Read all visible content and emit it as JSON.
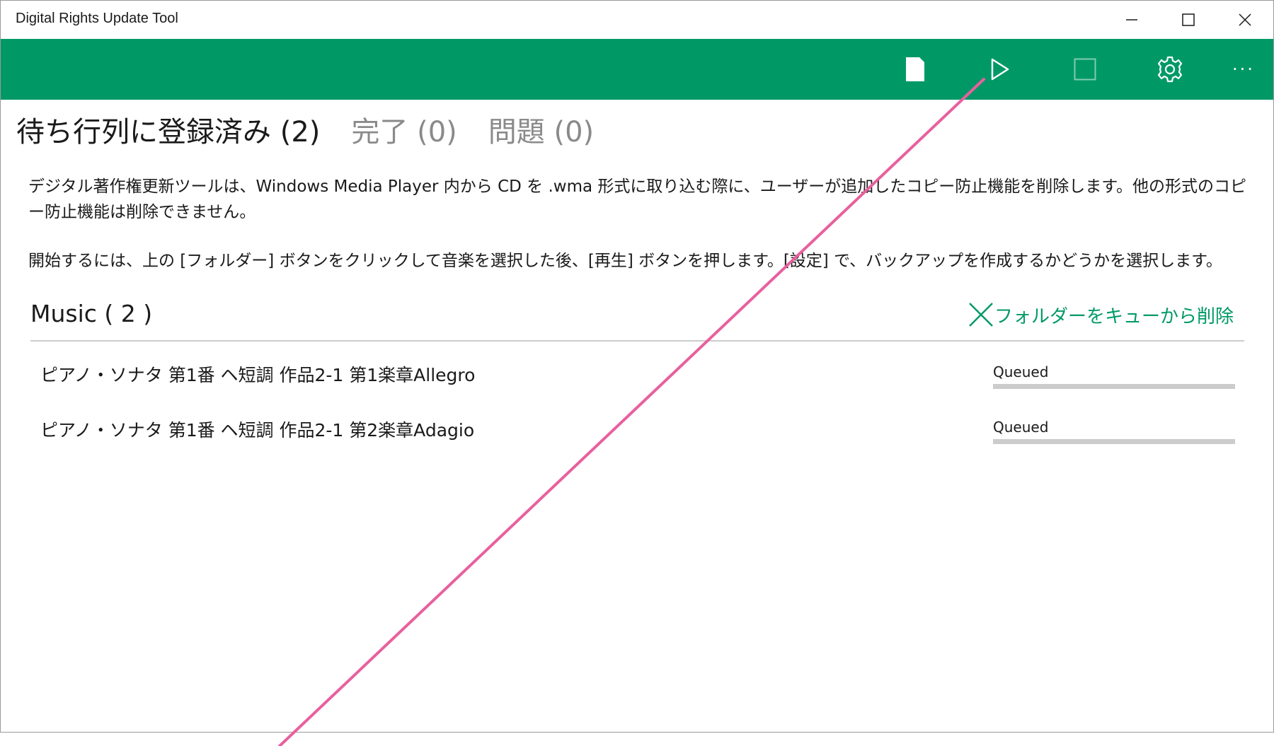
{
  "window": {
    "title": "Digital Rights Update Tool",
    "controls": [
      "minimize-icon",
      "maximize-icon",
      "close-icon"
    ]
  },
  "colors": {
    "accent": "#009966",
    "annotation": "#E8609E"
  },
  "command_bar": {
    "buttons": [
      {
        "name": "folder-icon"
      },
      {
        "name": "play-icon"
      },
      {
        "name": "stop-icon"
      },
      {
        "name": "gear-icon"
      },
      {
        "name": "more-icon",
        "label": "···"
      }
    ]
  },
  "tabs": [
    {
      "label": "待ち行列に登録済み (2)",
      "active": true
    },
    {
      "label": "完了 (0)",
      "active": false
    },
    {
      "label": "問題 (0)",
      "active": false
    }
  ],
  "description": {
    "paragraph1": "デジタル著作権更新ツールは、Windows Media Player 内から CD を .wma 形式に取り込む際に、ユーザーが追加したコピー防止機能を削除します。他の形式のコピー防止機能は削除できません。",
    "paragraph2": "開始するには、上の [フォルダー] ボタンをクリックして音楽を選択した後、[再生] ボタンを押します。[設定] で、バックアップを作成するかどうかを選択します。"
  },
  "folder": {
    "name": "Music ( 2 )",
    "remove_label": "フォルダーをキューから削除"
  },
  "tracks": [
    {
      "title": "ピアノ・ソナタ 第1番 ヘ短調 作品2-1 第1楽章Allegro",
      "status": "Queued",
      "progress": 0
    },
    {
      "title": "ピアノ・ソナタ 第1番 ヘ短調 作品2-1 第2楽章Adagio",
      "status": "Queued",
      "progress": 0
    }
  ]
}
